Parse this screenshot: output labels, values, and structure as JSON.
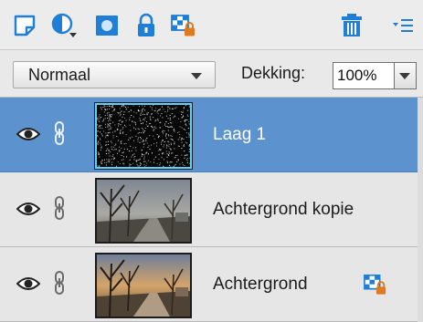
{
  "toolbar": {
    "buttons": [
      {
        "name": "new-layer-icon"
      },
      {
        "name": "adjustment-layer-icon"
      },
      {
        "name": "layer-mask-icon"
      },
      {
        "name": "lock-all-icon"
      },
      {
        "name": "lock-transparency-icon"
      },
      {
        "name": "delete-layer-icon"
      },
      {
        "name": "panel-menu-icon"
      }
    ]
  },
  "blend": {
    "mode": "Normaal",
    "opacity_label": "Dekking:",
    "opacity_value": "100%"
  },
  "layers": [
    {
      "name": "Laag 1",
      "selected": true,
      "visible": true,
      "linked": true,
      "locked": false
    },
    {
      "name": "Achtergrond kopie",
      "selected": false,
      "visible": true,
      "linked": true,
      "locked": false
    },
    {
      "name": "Achtergrond",
      "selected": false,
      "visible": true,
      "linked": true,
      "locked": true
    }
  ],
  "colors": {
    "selected_row": "#5c93cf",
    "selected_thumb_border": "#5ad1ff",
    "icon_blue": "#1f7fd6",
    "lock_orange": "#e07a1e"
  }
}
